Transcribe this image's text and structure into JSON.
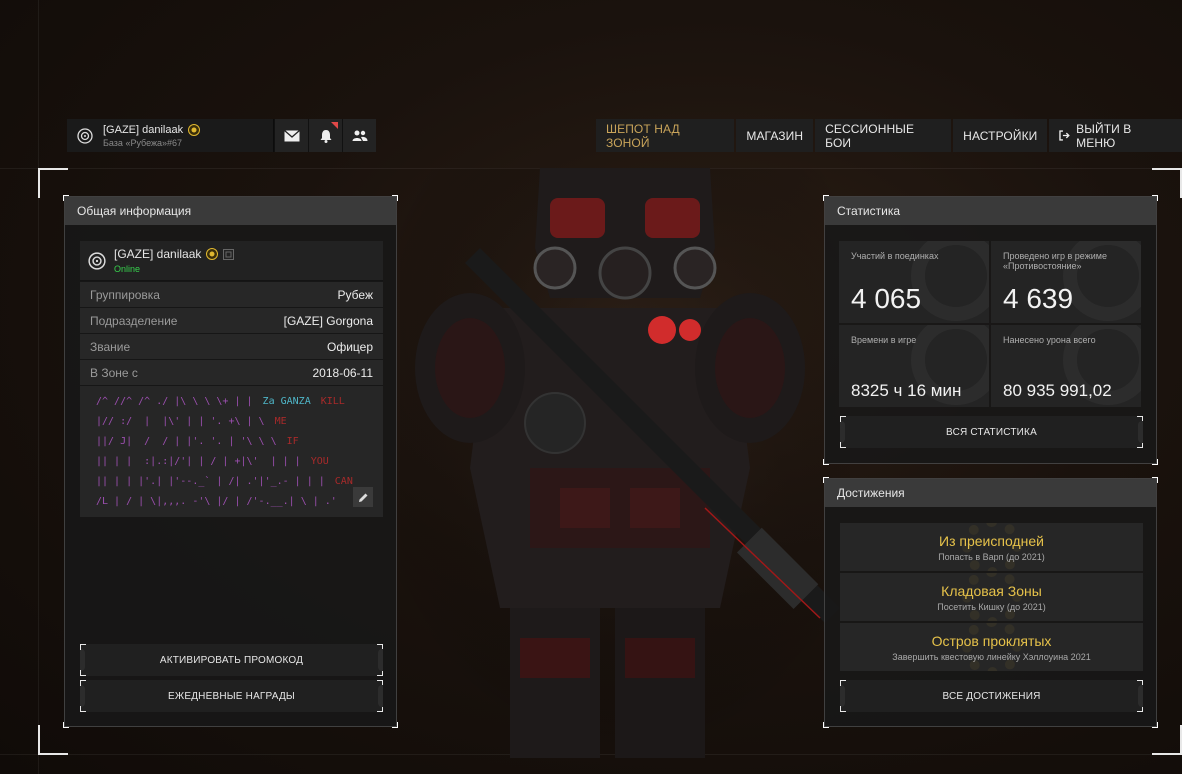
{
  "topbar": {
    "profile": {
      "name": "[GAZE] danilaak",
      "base": "База «Рубежа»#67"
    },
    "nav": [
      {
        "label": "ШЕПОТ НАД ЗОНОЙ",
        "active": true
      },
      {
        "label": "МАГАЗИН"
      },
      {
        "label": "СЕССИОННЫЕ БОИ"
      },
      {
        "label": "НАСТРОЙКИ"
      },
      {
        "label": "ВЫЙТИ В МЕНЮ"
      }
    ]
  },
  "info": {
    "title": "Общая информация",
    "player": {
      "name": "[GAZE] danilaak",
      "status": "Online"
    },
    "rows": [
      {
        "label": "Группировка",
        "value": "Рубеж"
      },
      {
        "label": "Подразделение",
        "value": "[GAZE] Gorgona"
      },
      {
        "label": "Звание",
        "value": "Офицер"
      },
      {
        "label": "В Зоне с",
        "value": "2018-06-11"
      }
    ],
    "bio_lines": [
      {
        "art": "/^ //^ /^ ./ |\\ \\ \\ \\+ | |",
        "tag": "Za GANZA",
        "tag2": "KILL"
      },
      {
        "art": "|// :/  |  |\\' | | '. +\\ | \\",
        "tag": "ME"
      },
      {
        "art": "||/ J|  /  / | |'. '. | '\\ \\ \\",
        "tag": "IF"
      },
      {
        "art": "|| | |  :|.:|/'| | / | +|\\'  | | |",
        "tag": "YOU"
      },
      {
        "art": "|| | | |'.| |'--._` | /| .'|'_.- | | |",
        "tag": "CAN"
      },
      {
        "art": "/L | / | \\|,,,. -'\\ |/ | /'-.__.| \\ | .'",
        "tag": ""
      }
    ],
    "buttons": {
      "promo": "АКТИВИРОВАТЬ ПРОМОКОД",
      "daily": "ЕЖЕДНЕВНЫЕ НАГРАДЫ"
    }
  },
  "stats": {
    "title": "Статистика",
    "cells": [
      {
        "label": "Участий в поединках",
        "value": "4 065"
      },
      {
        "label": "Проведено игр в режиме «Противостояние»",
        "value": "4 639"
      },
      {
        "label": "Времени в игре",
        "value": "8325 ч 16 мин"
      },
      {
        "label": "Нанесено урона всего",
        "value": "80 935 991,02"
      }
    ],
    "all_button": "ВСЯ СТАТИСТИКА"
  },
  "achievements": {
    "title": "Достижения",
    "items": [
      {
        "title": "Из преисподней",
        "desc": "Попасть в Варп (до 2021)"
      },
      {
        "title": "Кладовая Зоны",
        "desc": "Посетить Кишку (до 2021)"
      },
      {
        "title": "Остров проклятых",
        "desc": "Завершить квестовую линейку Хэллоуина 2021"
      }
    ],
    "all_button": "ВСЕ ДОСТИЖЕНИЯ"
  },
  "colors": {
    "accent_gold": "#c9a45a",
    "online_green": "#37d04d",
    "achievement_gold": "#e6c24a",
    "bio_purple": "#9c4fb0"
  }
}
